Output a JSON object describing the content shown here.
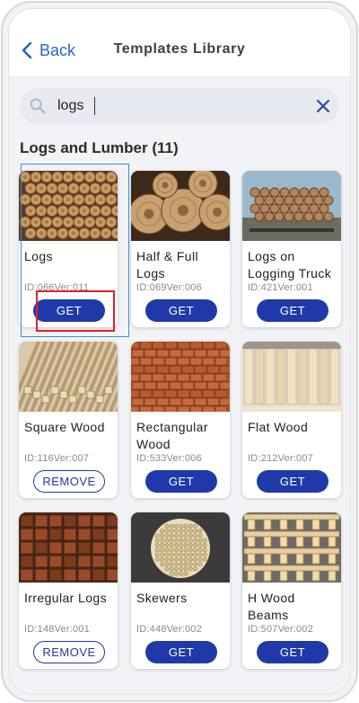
{
  "nav": {
    "back_label": "Back",
    "title": "Templates Library"
  },
  "search": {
    "value": "logs",
    "placeholder": ""
  },
  "section": {
    "title": "Logs and Lumber (11)"
  },
  "colors": {
    "accent": "#1f3aa8",
    "link": "#2a63c8"
  },
  "templates": [
    {
      "name": "Logs",
      "meta": "ID:066Ver:011",
      "action": "GET",
      "thumb": "log-ends"
    },
    {
      "name": "Half & Full Logs",
      "meta": "ID:069Ver:006",
      "action": "GET",
      "thumb": "log-half"
    },
    {
      "name": "Logs on Logging Truck",
      "meta": "ID:421Ver:001",
      "action": "GET",
      "thumb": "log-truck"
    },
    {
      "name": "Square Wood",
      "meta": "ID:116Ver:007",
      "action": "REMOVE",
      "thumb": "square-wood"
    },
    {
      "name": "Rectangular Wood",
      "meta": "ID:533Ver:006",
      "action": "GET",
      "thumb": "rect-wood"
    },
    {
      "name": "Flat Wood",
      "meta": "ID:212Ver:007",
      "action": "GET",
      "thumb": "flat-wood"
    },
    {
      "name": "Irregular Logs",
      "meta": "ID:148Ver:001",
      "action": "REMOVE",
      "thumb": "irregular"
    },
    {
      "name": "Skewers",
      "meta": "ID:448Ver:002",
      "action": "GET",
      "thumb": "skewers"
    },
    {
      "name": "H Wood Beams",
      "meta": "ID:507Ver:002",
      "action": "GET",
      "thumb": "h-beams"
    }
  ]
}
